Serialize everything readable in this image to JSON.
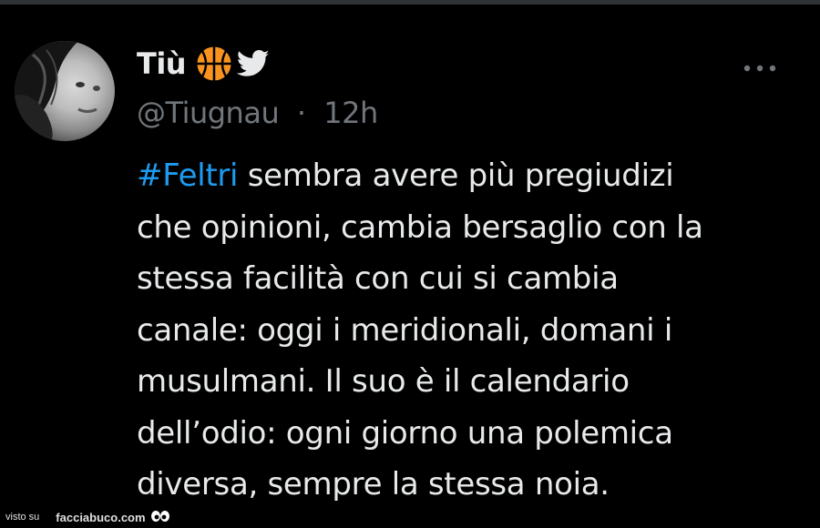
{
  "tweet": {
    "display_name": "Tiù",
    "handle": "@Tiugnau",
    "separator": "·",
    "time": "12h",
    "hashtag": "#Feltri",
    "line1_rest": " sembra avere più pregiudizi",
    "line2": "che opinioni, cambia bersaglio con la",
    "line3": "stessa facilità con cui si cambia",
    "line4": "canale: oggi i meridionali, domani i",
    "line5": "musulmani. Il suo è il calendario",
    "line6": "dell’odio: ogni giorno una polemica",
    "line7": "diversa, sempre la stessa noia.",
    "icons": {
      "name_emoji": "basketball-icon",
      "badge": "twitter-bird-icon",
      "menu": "more-options-icon"
    }
  },
  "colors": {
    "background": "#000000",
    "text": "#e7e9ea",
    "muted": "#71767b",
    "link": "#1d9bf0",
    "basketball": "#f7931e",
    "bird": "#e7e9ea"
  },
  "watermark": {
    "prefix": "visto su",
    "brand": "facciabuco.com"
  }
}
